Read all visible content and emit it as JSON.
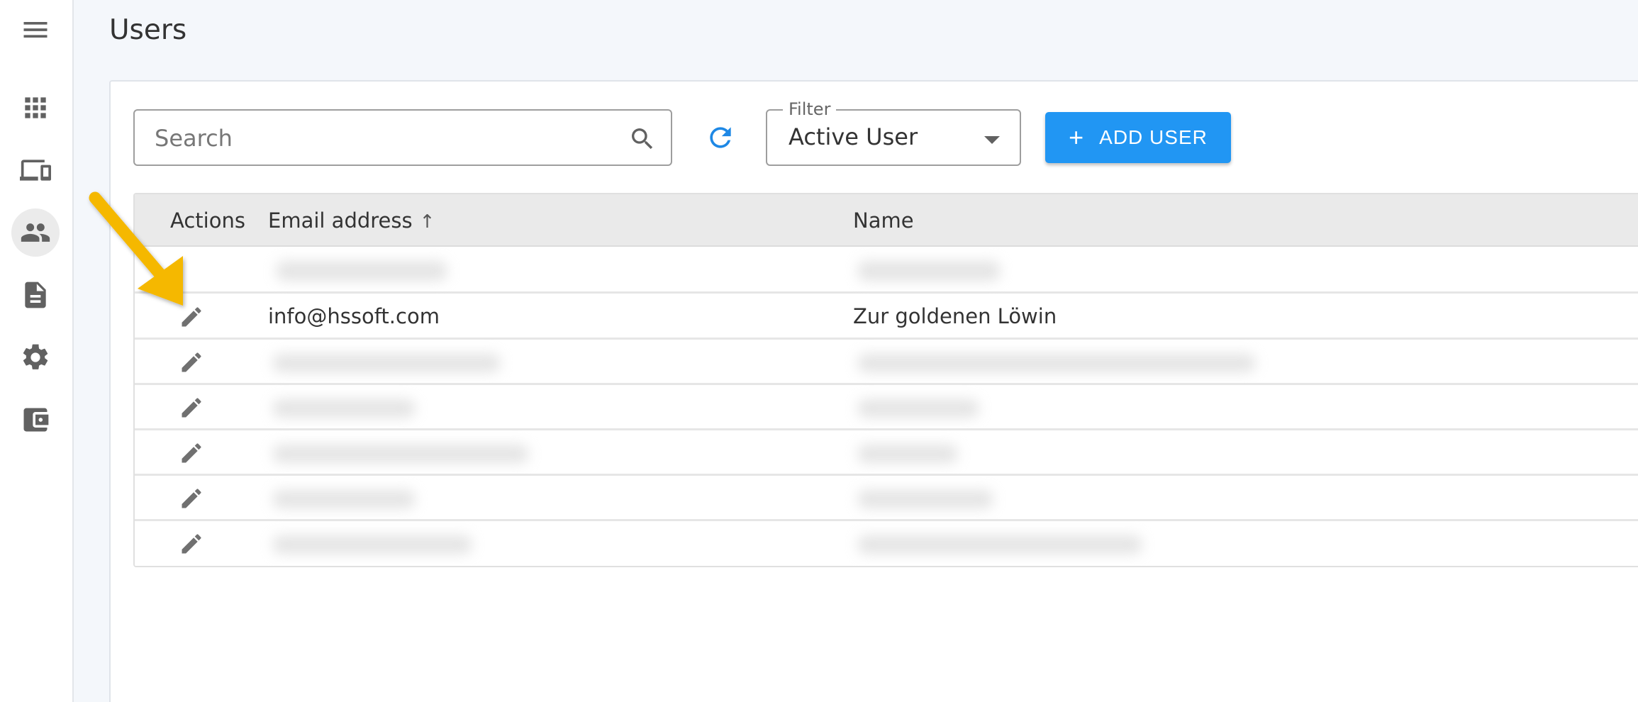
{
  "page": {
    "title": "Users"
  },
  "sidebar": {
    "items": [
      {
        "icon": "menu-icon"
      },
      {
        "icon": "apps-grid-icon"
      },
      {
        "icon": "devices-icon"
      },
      {
        "icon": "users-icon",
        "active": true
      },
      {
        "icon": "document-icon"
      },
      {
        "icon": "settings-gear-icon"
      },
      {
        "icon": "wallet-icon"
      }
    ]
  },
  "toolbar": {
    "search_placeholder": "Search",
    "search_value": "",
    "filter_label": "Filter",
    "filter_value": "Active User",
    "add_user_label": "ADD USER"
  },
  "table": {
    "columns": {
      "actions": "Actions",
      "email": "Email address",
      "name": "Name"
    },
    "sort": {
      "column": "Email address",
      "direction": "ascending"
    },
    "rows": [
      {
        "email": "",
        "name": "",
        "blurred": true
      },
      {
        "email": "info@hssoft.com",
        "name": "Zur goldenen Löwin",
        "blurred": false
      },
      {
        "email": "",
        "name": "",
        "blurred": true
      },
      {
        "email": "",
        "name": "",
        "blurred": true
      },
      {
        "email": "",
        "name": "",
        "blurred": true
      },
      {
        "email": "",
        "name": "",
        "blurred": true
      },
      {
        "email": "",
        "name": "",
        "blurred": true
      }
    ]
  },
  "colors": {
    "accent": "#2196f3",
    "annotation_arrow": "#f5b800",
    "sidebar_icon": "#616161"
  }
}
